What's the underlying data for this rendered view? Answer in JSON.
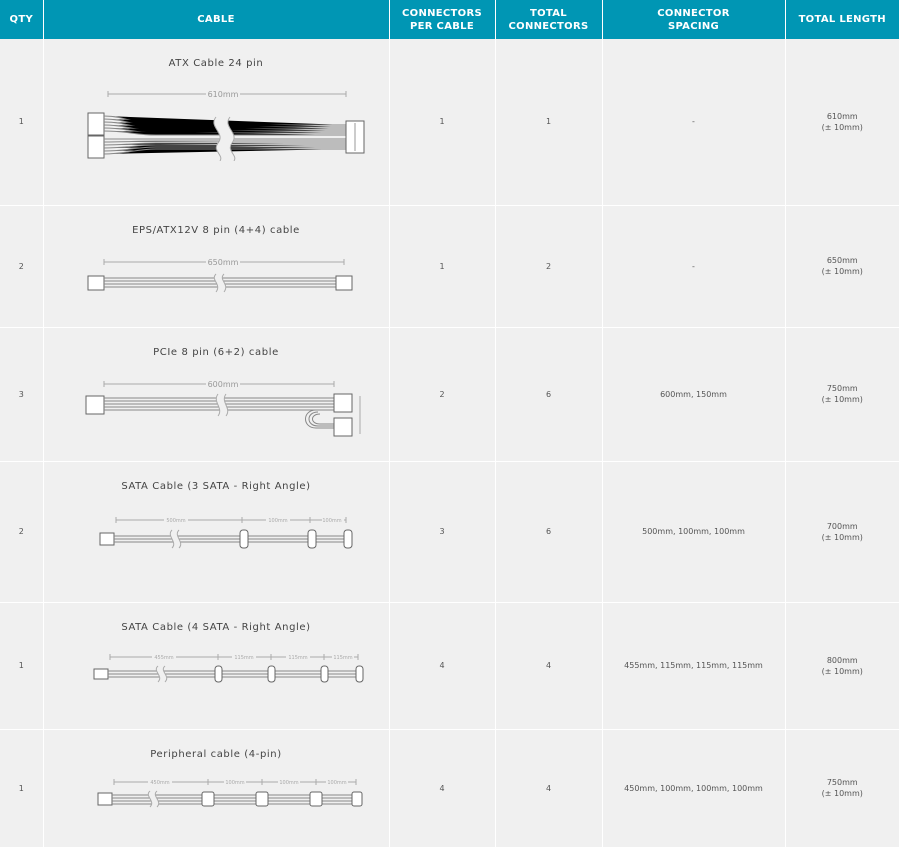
{
  "headers": {
    "qty": "QTY",
    "cable": "CABLE",
    "per_cable": [
      "CONNECTORS",
      "PER CABLE"
    ],
    "total": [
      "TOTAL",
      "CONNECTORS"
    ],
    "spacing": [
      "CONNECTOR",
      "SPACING"
    ],
    "length": "TOTAL LENGTH"
  },
  "rows": [
    {
      "qty": "1",
      "name": "ATX Cable 24 pin",
      "per_cable": "1",
      "total": "1",
      "spacing": "-",
      "length": "610mm",
      "tolerance": "(± 10mm)",
      "diagram_label": "610mm",
      "diagram_icon": "atx-24pin-cable-icon"
    },
    {
      "qty": "2",
      "name": "EPS/ATX12V 8 pin (4+4) cable",
      "per_cable": "1",
      "total": "2",
      "spacing": "-",
      "length": "650mm",
      "tolerance": "(± 10mm)",
      "diagram_label": "650mm",
      "diagram_icon": "eps-8pin-cable-icon"
    },
    {
      "qty": "3",
      "name": "PCIe 8 pin (6+2) cable",
      "per_cable": "2",
      "total": "6",
      "spacing": "600mm, 150mm",
      "length": "750mm",
      "tolerance": "(± 10mm)",
      "diagram_label": "600mm",
      "diagram_icon": "pcie-8pin-cable-icon"
    },
    {
      "qty": "2",
      "name": "SATA Cable (3 SATA - Right Angle)",
      "per_cable": "3",
      "total": "6",
      "spacing": "500mm, 100mm, 100mm",
      "length": "700mm",
      "tolerance": "(± 10mm)",
      "diagram_labels": [
        "500mm",
        "100mm",
        "100mm"
      ],
      "diagram_icon": "sata-3-cable-icon"
    },
    {
      "qty": "1",
      "name": "SATA Cable (4 SATA - Right Angle)",
      "per_cable": "4",
      "total": "4",
      "spacing": "455mm, 115mm, 115mm, 115mm",
      "length": "800mm",
      "tolerance": "(± 10mm)",
      "diagram_labels": [
        "455mm",
        "115mm",
        "115mm",
        "115mm"
      ],
      "diagram_icon": "sata-4-cable-icon"
    },
    {
      "qty": "1",
      "name": "Peripheral cable (4-pin)",
      "per_cable": "4",
      "total": "4",
      "spacing": "450mm, 100mm, 100mm, 100mm",
      "length": "750mm",
      "tolerance": "(± 10mm)",
      "diagram_labels": [
        "450mm",
        "100mm",
        "100mm",
        "100mm"
      ],
      "diagram_icon": "peripheral-4pin-cable-icon"
    }
  ]
}
